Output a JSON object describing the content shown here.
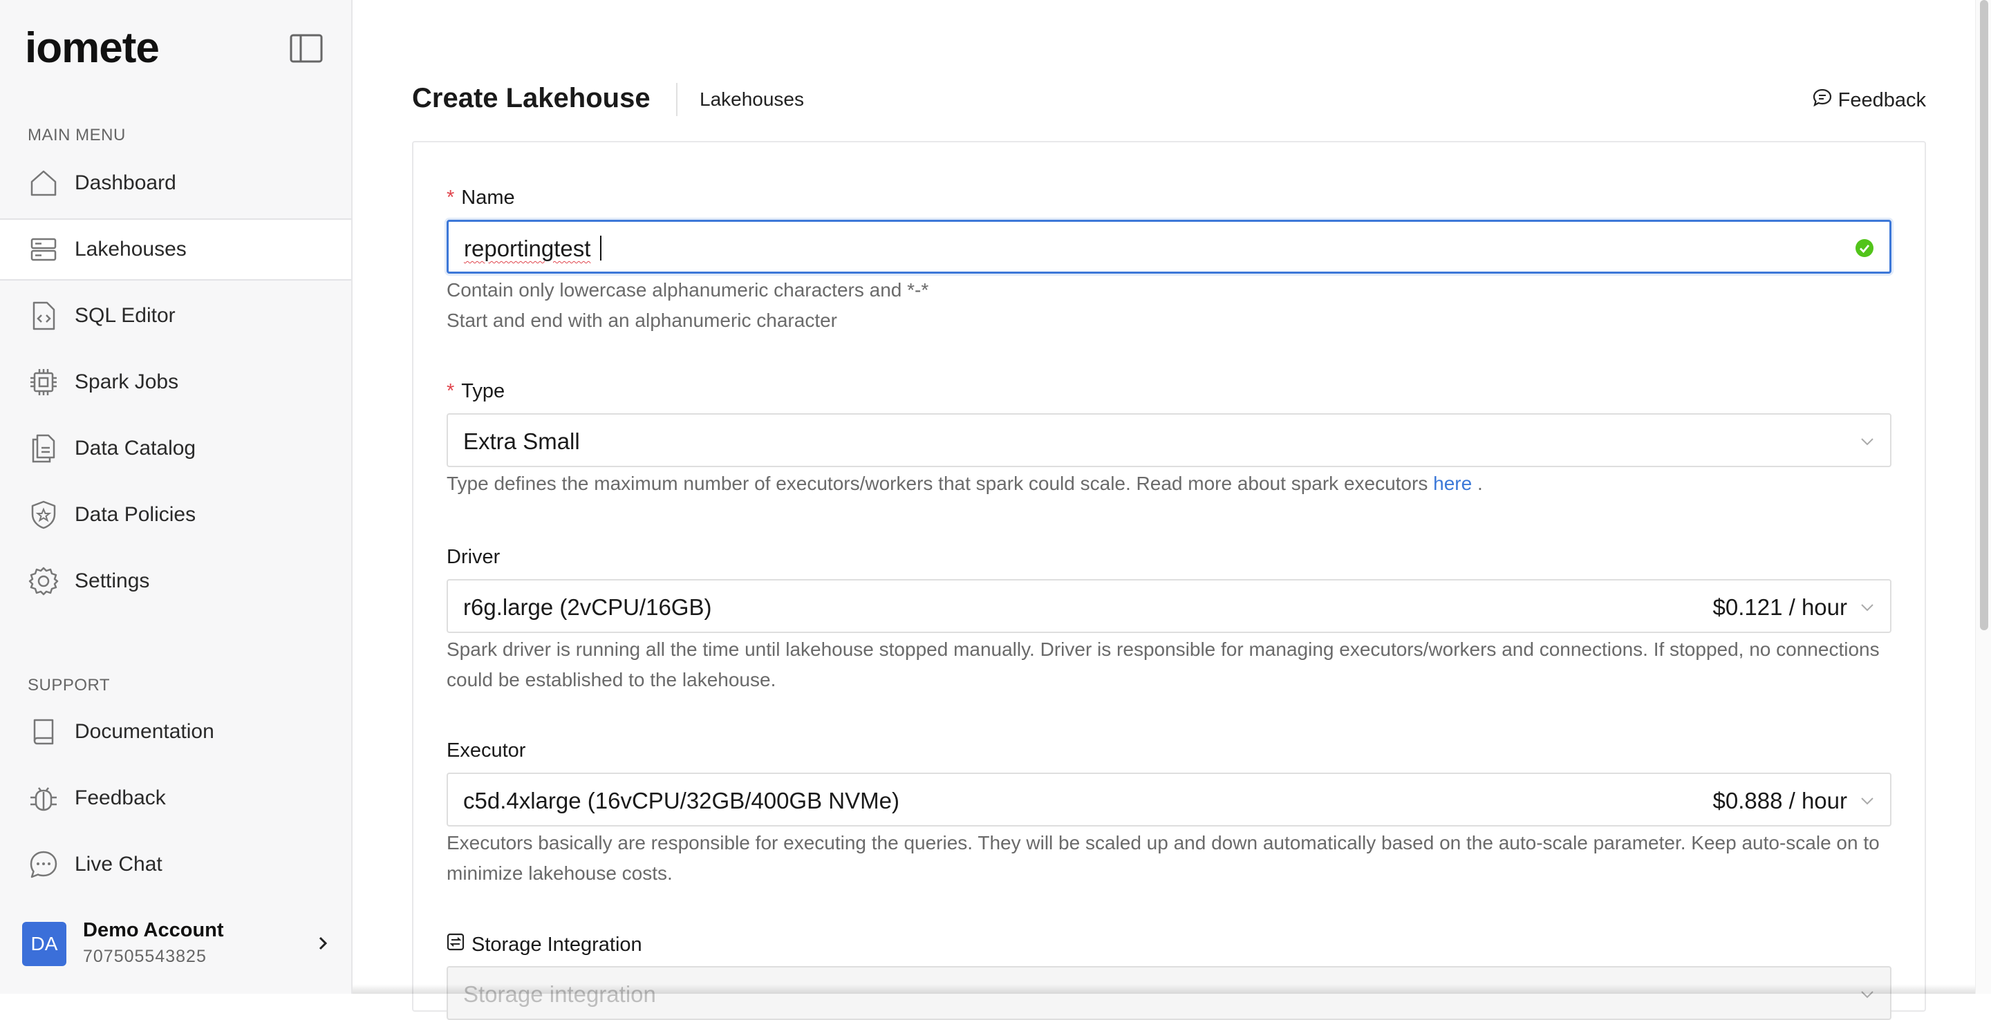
{
  "sidebar": {
    "logo": "iomete",
    "main_menu_label": "MAIN MENU",
    "support_label": "SUPPORT",
    "main_items": [
      {
        "label": "Dashboard",
        "icon": "home-icon"
      },
      {
        "label": "Lakehouses",
        "icon": "server-icon",
        "active": true
      },
      {
        "label": "SQL Editor",
        "icon": "code-file-icon"
      },
      {
        "label": "Spark Jobs",
        "icon": "chip-icon"
      },
      {
        "label": "Data Catalog",
        "icon": "documents-icon"
      },
      {
        "label": "Data Policies",
        "icon": "shield-icon"
      },
      {
        "label": "Settings",
        "icon": "gear-icon"
      }
    ],
    "support_items": [
      {
        "label": "Documentation",
        "icon": "book-icon"
      },
      {
        "label": "Feedback",
        "icon": "bug-icon"
      },
      {
        "label": "Live Chat",
        "icon": "chat-icon"
      }
    ],
    "account": {
      "initials": "DA",
      "name": "Demo Account",
      "id": "707505543825"
    }
  },
  "header": {
    "title": "Create Lakehouse",
    "breadcrumb": "Lakehouses",
    "feedback": "Feedback"
  },
  "form": {
    "name": {
      "label": "Name",
      "value": "reportingtest",
      "help1": "Contain only lowercase alphanumeric characters and *-*",
      "help2": "Start and end with an alphanumeric character"
    },
    "type": {
      "label": "Type",
      "value": "Extra Small",
      "help": "Type defines the maximum number of executors/workers that spark could scale. Read more about spark executors",
      "link": "here",
      "help_end": "."
    },
    "driver": {
      "label": "Driver",
      "value": "r6g.large (2vCPU/16GB)",
      "price": "$0.121 / hour",
      "help": "Spark driver is running all the time until lakehouse stopped manually. Driver is responsible for managing executors/workers and connections. If stopped, no connections could be established to the lakehouse."
    },
    "executor": {
      "label": "Executor",
      "value": "c5d.4xlarge (16vCPU/32GB/400GB NVMe)",
      "price": "$0.888 / hour",
      "help": "Executors basically are responsible for executing the queries. They will be scaled up and down automatically based on the auto-scale parameter. Keep auto-scale on to minimize lakehouse costs."
    },
    "storage": {
      "label": "Storage Integration",
      "placeholder": "Storage integration"
    }
  },
  "colors": {
    "accent": "#3d78d8",
    "required": "#e0464e",
    "valid": "#52c41a",
    "avatar": "#3b6fd9"
  }
}
